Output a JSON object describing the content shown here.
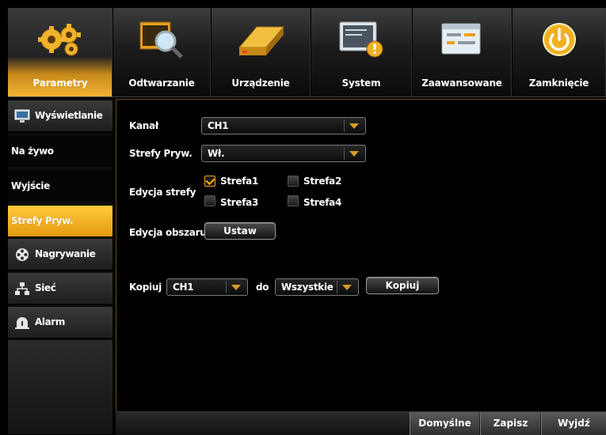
{
  "topbar": {
    "items": [
      {
        "label": "Parametry",
        "icon": "gears-icon",
        "active": true
      },
      {
        "label": "Odtwarzanie",
        "icon": "playback-search-icon"
      },
      {
        "label": "Urządzenie",
        "icon": "hard-drive-icon"
      },
      {
        "label": "System",
        "icon": "system-info-icon"
      },
      {
        "label": "Zaawansowane",
        "icon": "advanced-settings-icon"
      },
      {
        "label": "Zamknięcie",
        "icon": "power-icon"
      }
    ]
  },
  "sidebar": {
    "items": [
      {
        "label": "Wyświetlanie",
        "icon": "monitor-icon"
      },
      {
        "label": "Na żywo"
      },
      {
        "label": "Wyjście"
      },
      {
        "label": "Strefy Pryw.",
        "active": true
      },
      {
        "label": "Nagrywanie",
        "icon": "film-reel-icon"
      },
      {
        "label": "Sieć",
        "icon": "network-icon"
      },
      {
        "label": "Alarm",
        "icon": "alarm-icon"
      }
    ]
  },
  "form": {
    "kanal": {
      "label": "Kanał",
      "value": "CH1"
    },
    "strefy": {
      "label": "Strefy Pryw.",
      "value": "Wł."
    },
    "edycja_strefy": {
      "label": "Edycja strefy",
      "zones": [
        {
          "label": "Strefa1",
          "checked": true
        },
        {
          "label": "Strefa2",
          "checked": false
        },
        {
          "label": "Strefa3",
          "checked": false
        },
        {
          "label": "Strefa4",
          "checked": false
        }
      ]
    },
    "edycja_obszaru": {
      "label": "Edycja obszaru",
      "button": "Ustaw"
    },
    "kopiuj": {
      "label": "Kopiuj",
      "source": "CH1",
      "to_label": "do",
      "target": "Wszystkie",
      "button": "Kopiuj"
    }
  },
  "bottom": {
    "default_label": "Domyślne",
    "save_label": "Zapisz",
    "exit_label": "Wyjdź"
  },
  "colors": {
    "accent": "#f2b233",
    "background": "#000000"
  }
}
